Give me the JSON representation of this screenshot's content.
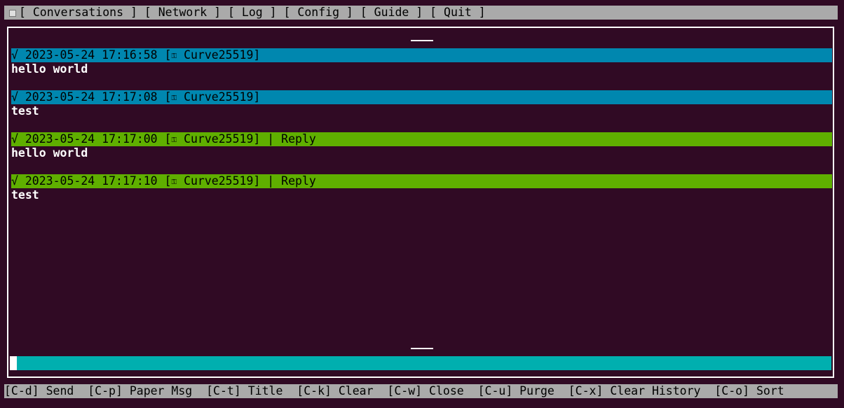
{
  "menu": {
    "items": [
      "[ Conversations ]",
      "[ Network ]",
      "[ Log ]",
      "[ Config ]",
      "[ Guide ]",
      "[ Quit ]"
    ]
  },
  "messages": [
    {
      "check": "√",
      "timestamp": "2023-05-24 17:16:58",
      "open_bracket": "[",
      "key_glyph": "⚿",
      "method": "Curve25519]",
      "suffix": "",
      "body": "hello world"
    },
    {
      "check": "√",
      "timestamp": "2023-05-24 17:17:08",
      "open_bracket": "[",
      "key_glyph": "⚿",
      "method": "Curve25519]",
      "suffix": "",
      "body": "test"
    },
    {
      "check": "√",
      "timestamp": "2023-05-24 17:17:00",
      "open_bracket": "[",
      "key_glyph": "⚿",
      "method": "Curve25519]",
      "suffix": " | Reply",
      "body": "hello world"
    },
    {
      "check": "√",
      "timestamp": "2023-05-24 17:17:10",
      "open_bracket": "[",
      "key_glyph": "⚿",
      "method": "Curve25519]",
      "suffix": " | Reply",
      "body": "test"
    }
  ],
  "input": {
    "value": ""
  },
  "hotkeys": [
    "[C-d] Send",
    "[C-p] Paper Msg",
    "[C-t] Title",
    "[C-k] Clear",
    "[C-w] Close",
    "[C-u] Purge",
    "[C-x] Clear History",
    "[C-o] Sort"
  ],
  "colors": {
    "background": "#300a24",
    "sent_header": "#0087af",
    "reply_header": "#5faf00",
    "input_bar": "#00afaf",
    "bars": "#aaaaaa"
  }
}
